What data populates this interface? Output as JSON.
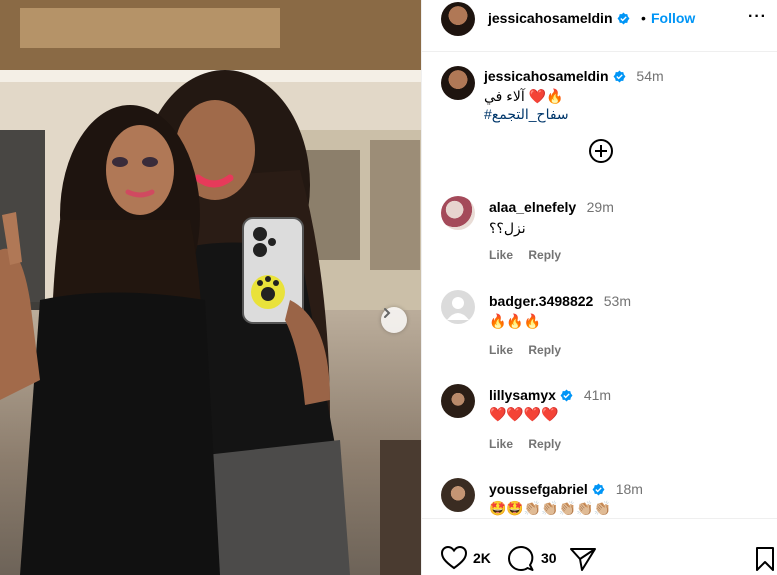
{
  "post": {
    "author": "jessicahosameldin",
    "follow_label": "Follow",
    "dot": "•",
    "more": "···"
  },
  "caption": {
    "author": "jessicahosameldin",
    "time": "54m",
    "emojis": "❤️🔥",
    "text": "آلاء في",
    "hashtag": "#سفاح_التجمع"
  },
  "comments": [
    {
      "user": "alaa_elnefely",
      "time": "29m",
      "text": "نزل؟؟",
      "verified": false,
      "like": "Like",
      "reply": "Reply"
    },
    {
      "user": "badger.3498822",
      "time": "53m",
      "text": "🔥🔥🔥",
      "verified": false,
      "like": "Like",
      "reply": "Reply"
    },
    {
      "user": "lillysamyx",
      "time": "41m",
      "text": "❤️❤️❤️❤️",
      "verified": true,
      "like": "Like",
      "reply": "Reply"
    },
    {
      "user": "youssefgabriel",
      "time": "18m",
      "text": "🤩🤩👏🏼👏🏼👏🏼👏🏼👏🏼",
      "verified": true
    }
  ],
  "actions": {
    "likes": "2K",
    "comments": "30"
  },
  "colors": {
    "accent": "#0095f6",
    "verified": "#0095f6",
    "hashtag": "#00376b",
    "muted": "#737373"
  },
  "icons": [
    "verified-icon",
    "more-icon",
    "add-comment-icon",
    "heart-icon",
    "comment-icon",
    "share-icon",
    "bookmark-icon",
    "next-arrow-icon"
  ]
}
